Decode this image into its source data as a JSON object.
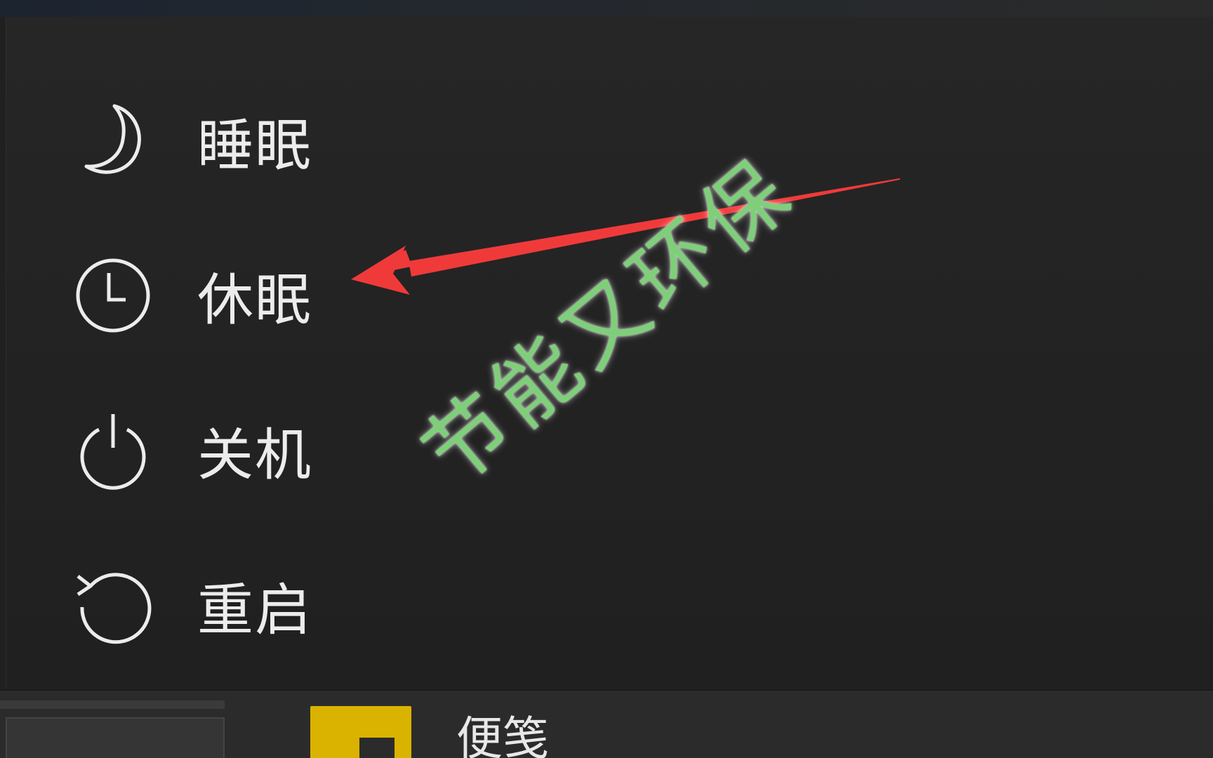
{
  "power_menu": {
    "items": [
      {
        "label": "睡眠",
        "icon": "moon-icon"
      },
      {
        "label": "休眠",
        "icon": "clock-icon"
      },
      {
        "label": "关机",
        "icon": "power-icon"
      },
      {
        "label": "重启",
        "icon": "restart-icon"
      }
    ]
  },
  "taskbar": {
    "app_label": "便笺",
    "app_tile_color": "#d9b300"
  },
  "annotation": {
    "overlay_text": "节能又环保",
    "text_color": "#7fcf7a",
    "arrow_color": "#f03a3a"
  }
}
